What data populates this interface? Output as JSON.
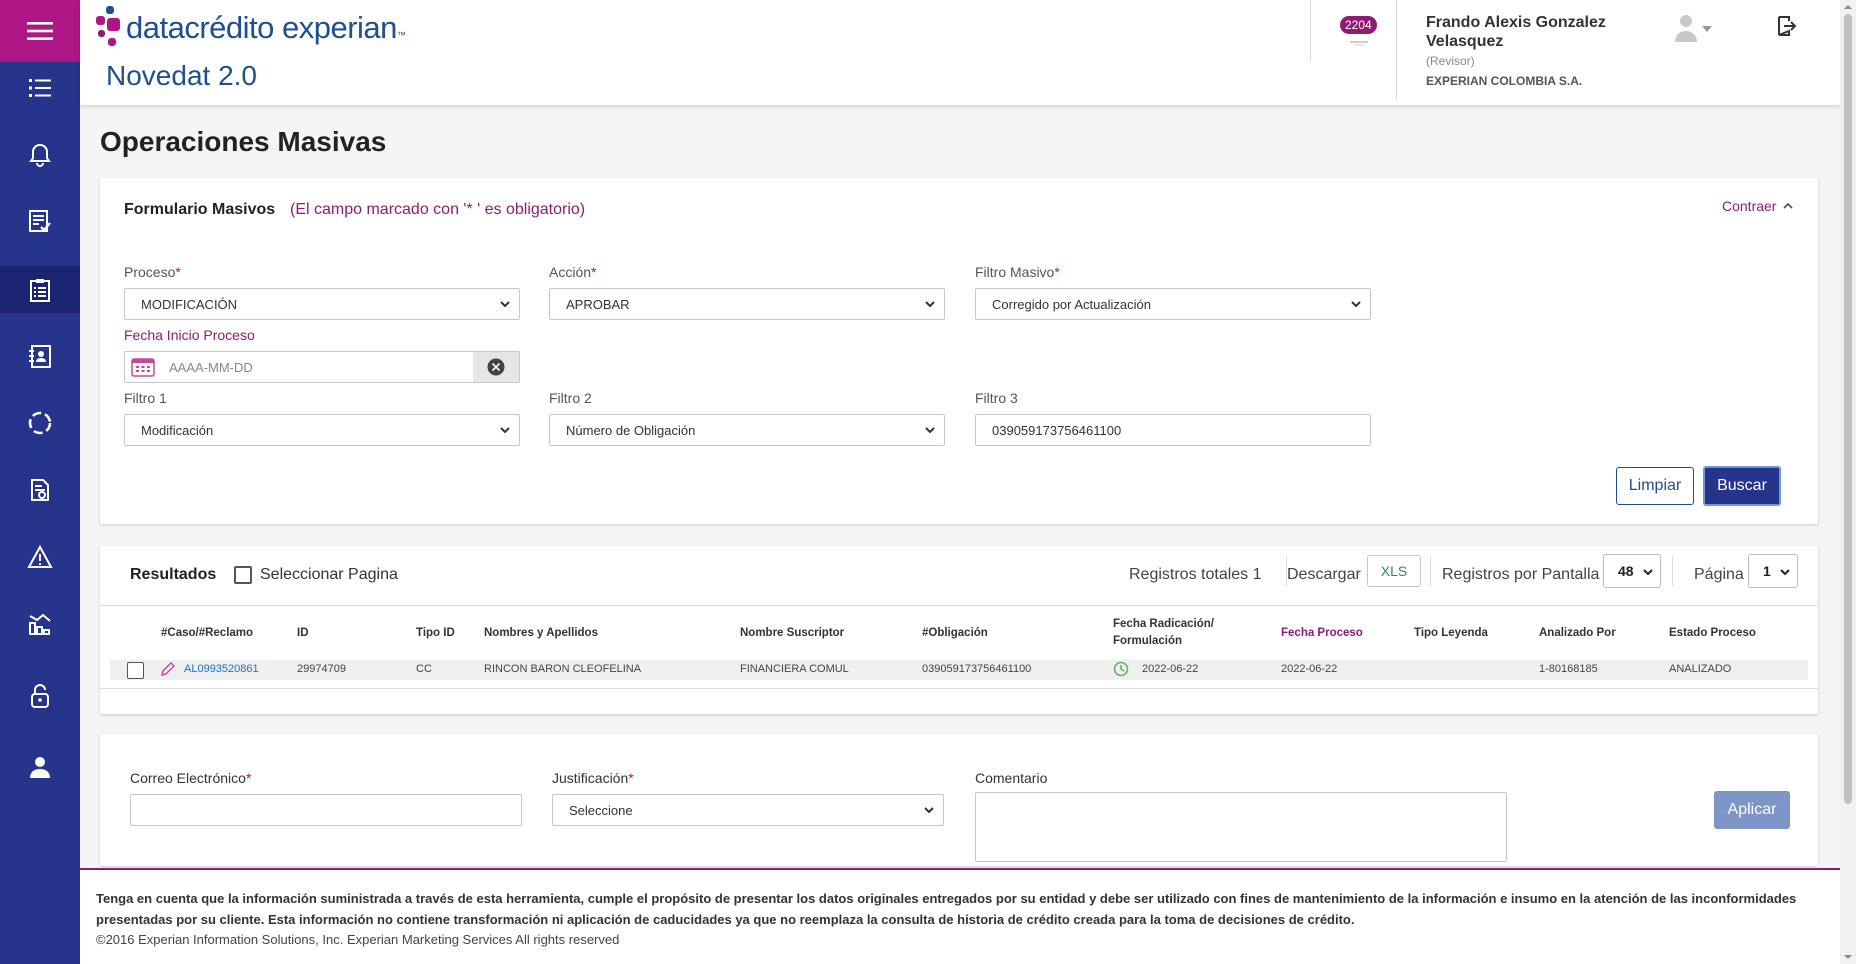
{
  "header": {
    "logo_text": "datacrédito experian",
    "logo_tm": "™",
    "app_title": "Novedat 2.0",
    "notification_count": "2204",
    "user_name": "Frando Alexis Gonzalez Velasquez",
    "user_role": "(Revisor)",
    "user_company": "EXPERIAN COLOMBIA S.A."
  },
  "sidebar": {
    "items": [
      {
        "icon": "list-icon"
      },
      {
        "icon": "bell-icon"
      },
      {
        "icon": "checklist-icon"
      },
      {
        "icon": "clipboard-icon",
        "active": true
      },
      {
        "icon": "contacts-book-icon"
      },
      {
        "icon": "refresh-circle-icon"
      },
      {
        "icon": "document-search-icon"
      },
      {
        "icon": "warning-icon"
      },
      {
        "icon": "chart-report-icon"
      },
      {
        "icon": "unlock-icon"
      },
      {
        "icon": "user-icon"
      }
    ]
  },
  "page": {
    "title": "Operaciones Masivas"
  },
  "form": {
    "title": "Formulario Masivos",
    "note": "(El campo marcado con '* ' es obligatorio)",
    "collapse_label": "Contraer",
    "required_mark": "*",
    "proceso_label": "Proceso",
    "proceso_value": "MODIFICACIÓN",
    "accion_label": "Acción",
    "accion_value": "APROBAR",
    "filtro_masivo_label": "Filtro Masivo",
    "filtro_masivo_value": "Corregido por Actualización",
    "fecha_label": "Fecha Inicio Proceso",
    "fecha_placeholder": "AAAA-MM-DD",
    "filtro1_label": "Filtro 1",
    "filtro1_value": "Modificación",
    "filtro2_label": "Filtro 2",
    "filtro2_value": "Número de Obligación",
    "filtro3_label": "Filtro 3",
    "filtro3_value": "039059173756461100",
    "clear_label": "Limpiar",
    "search_label": "Buscar"
  },
  "results": {
    "title": "Resultados",
    "select_page_label": "Seleccionar Pagina",
    "total_label": "Registros totales 1",
    "download_label": "Descargar",
    "xls_label": "XLS",
    "per_page_label": "Registros por Pantalla",
    "per_page_value": "48",
    "page_label": "Página",
    "page_value": "1",
    "columns": {
      "caso": "#Caso/#Reclamo",
      "id": "ID",
      "tipo_id": "Tipo ID",
      "nombres": "Nombres y Apellidos",
      "suscriptor": "Nombre Suscriptor",
      "obligacion": "#Obligación",
      "fecha_radicacion_1": "Fecha Radicación/",
      "fecha_radicacion_2": "Formulación",
      "fecha_proceso": "Fecha Proceso",
      "tipo_leyenda": "Tipo Leyenda",
      "analizado_por": "Analizado Por",
      "estado": "Estado Proceso"
    },
    "rows": [
      {
        "caso": "AL0993520861",
        "id": "29974709",
        "tipo_id": "CC",
        "nombres": "RINCON BARON CLEOFELINA",
        "suscriptor": "FINANCIERA COMUL",
        "obligacion": "039059173756461100",
        "fecha_radicacion": "2022-06-22",
        "fecha_proceso": "2022-06-22",
        "tipo_leyenda": "",
        "analizado_por": "1-80168185",
        "estado": "ANALIZADO"
      }
    ]
  },
  "apply_form": {
    "email_label": "Correo Electrónico",
    "justificacion_label": "Justificación",
    "justificacion_value": "Seleccione",
    "comentario_label": "Comentario",
    "apply_label": "Aplicar"
  },
  "footer": {
    "disclaimer": "Tenga en cuenta que la información suministrada a través de esta herramienta, cumple el propósito de presentar los datos originales entregados por su entidad y debe ser utilizado con fines de mantenimiento de la información e insumo en la atención de las inconformidades presentadas por su cliente. Esta información no contiene transformación ni aplicación de caducidades ya que no reemplaza la consulta de historia de crédito creada para la toma de decisiones de crédito.",
    "copyright": "©2016 Experian Information Solutions, Inc. Experian Marketing Services All rights reserved"
  },
  "colors": {
    "sidebar": "#27348b",
    "brand_magenta": "#af1685",
    "brand_blue": "#1d4f91",
    "accent_pink": "#8e1b74"
  }
}
